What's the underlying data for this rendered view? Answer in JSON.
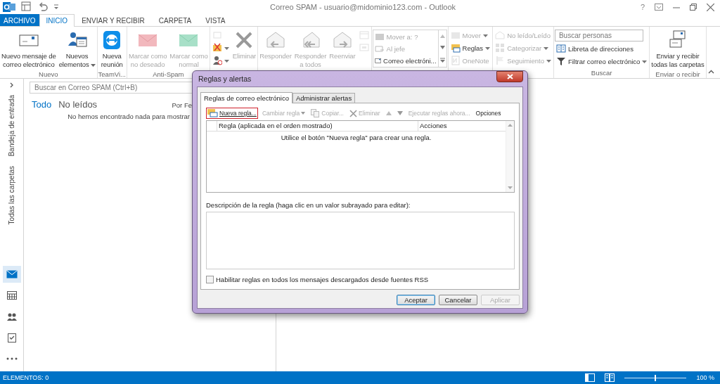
{
  "window": {
    "title": "Correo SPAM - usuario@midominio123.com - Outlook",
    "help": "?"
  },
  "ribbon_tabs": [
    {
      "label": "ARCHIVO",
      "kind": "file",
      "selected": false
    },
    {
      "label": "INICIO",
      "kind": "tab",
      "selected": true
    },
    {
      "label": "ENVIAR Y RECIBIR",
      "kind": "tab",
      "selected": false
    },
    {
      "label": "CARPETA",
      "kind": "tab",
      "selected": false
    },
    {
      "label": "VISTA",
      "kind": "tab",
      "selected": false
    }
  ],
  "ribbon_groups": [
    {
      "label": "Nuevo",
      "items": [
        {
          "kind": "large",
          "lines": [
            "Nuevo mensaje de",
            "correo electrónico"
          ],
          "dropdown": false,
          "disabled": false
        },
        {
          "kind": "large",
          "lines": [
            "Nuevos",
            "elementos"
          ],
          "dropdown": true,
          "disabled": false
        }
      ]
    },
    {
      "label": "TeamVi...",
      "items": [
        {
          "kind": "large",
          "lines": [
            "Nueva",
            "reunión"
          ],
          "dropdown": false,
          "disabled": false
        }
      ]
    },
    {
      "label": "Anti-Spam",
      "items": [
        {
          "kind": "large",
          "lines": [
            "Marcar como",
            "no deseado"
          ],
          "dropdown": false,
          "disabled": true
        },
        {
          "kind": "large",
          "lines": [
            "Marcar como",
            "normal"
          ],
          "dropdown": false,
          "disabled": true
        }
      ]
    },
    {
      "items": [
        {
          "kind": "stack",
          "items": [
            {
              "dropdown": false,
              "disabled": true
            },
            {
              "dropdown": true,
              "disabled": false
            },
            {
              "dropdown": true,
              "disabled": false
            }
          ]
        },
        {
          "kind": "large",
          "lines": [
            "Eliminar"
          ],
          "dropdown": false,
          "disabled": true
        }
      ]
    },
    {
      "items": [
        {
          "kind": "large",
          "lines": [
            "Responder"
          ],
          "dropdown": false,
          "disabled": true
        },
        {
          "kind": "large",
          "lines": [
            "Responder",
            "a todos"
          ],
          "dropdown": false,
          "disabled": true
        },
        {
          "kind": "large",
          "lines": [
            "Reenviar"
          ],
          "dropdown": false,
          "disabled": true
        },
        {
          "kind": "stack",
          "items": [
            {
              "dropdown": false,
              "disabled": true
            },
            {
              "dropdown": false,
              "disabled": true
            }
          ]
        }
      ]
    },
    {
      "items": [
        {
          "kind": "gallery",
          "items": [
            {
              "label": "Mover a: ?",
              "disabled": true
            },
            {
              "label": "Al jefe",
              "disabled": true
            },
            {
              "label": "Correo electróni...",
              "disabled": false
            }
          ]
        }
      ]
    },
    {
      "items": [
        {
          "kind": "stack",
          "items": [
            {
              "label": "Mover",
              "dropdown": true,
              "disabled": true
            },
            {
              "label": "Reglas",
              "dropdown": true,
              "disabled": false
            },
            {
              "label": "OneNote",
              "dropdown": false,
              "disabled": true
            }
          ]
        }
      ]
    },
    {
      "items": [
        {
          "kind": "stack",
          "items": [
            {
              "label": "No leído/Leído",
              "dropdown": false,
              "disabled": true
            },
            {
              "label": "Categorizar",
              "dropdown": true,
              "disabled": true
            },
            {
              "label": "Seguimiento",
              "dropdown": true,
              "disabled": true
            }
          ]
        }
      ]
    },
    {
      "label": "Buscar",
      "items": [
        {
          "kind": "stack",
          "items": [
            {
              "kind": "search",
              "placeholder": "Buscar personas"
            },
            {
              "label": "Libreta de direcciones",
              "dropdown": false,
              "disabled": false
            },
            {
              "label": "Filtrar correo electrónico",
              "dropdown": true,
              "disabled": false
            }
          ]
        }
      ]
    },
    {
      "label": "Enviar o recibir",
      "items": [
        {
          "kind": "large",
          "lines": [
            "Enviar y recibir",
            "todas las carpetas"
          ],
          "dropdown": false,
          "disabled": false
        }
      ]
    }
  ],
  "nav_pane": {
    "labels": [
      "Bandeja de entrada",
      "Todas las carpetas"
    ],
    "modules": [
      {
        "selected": true
      },
      {
        "selected": false
      },
      {
        "selected": false
      },
      {
        "selected": false
      },
      {
        "selected": false
      }
    ]
  },
  "message_list": {
    "search": {
      "placeholder": "Buscar en Correo SPAM (Ctrl+B)"
    },
    "filters": [
      {
        "label": "Todo",
        "selected": true
      },
      {
        "label": "No leídos",
        "selected": false
      }
    ],
    "sort": "Por Fe",
    "empty_text": "No hemos encontrado nada para mostrar"
  },
  "dialog": {
    "title": "Reglas y alertas",
    "tabs": [
      {
        "label": "Reglas de correo electrónico",
        "selected": true
      },
      {
        "label": "Administrar alertas",
        "selected": false
      }
    ],
    "toolbar": [
      {
        "label": "Nueva regla...",
        "kind": "new",
        "highlighted": true,
        "dropdown": false,
        "disabled": false
      },
      {
        "label": "Cambiar regla",
        "kind": "text",
        "highlighted": false,
        "dropdown": true,
        "disabled": true
      },
      {
        "label": "Copiar...",
        "kind": "copy",
        "highlighted": false,
        "dropdown": false,
        "disabled": true
      },
      {
        "label": "Eliminar",
        "kind": "delete",
        "highlighted": false,
        "dropdown": false,
        "disabled": true
      },
      {
        "kind": "up",
        "highlighted": false,
        "dropdown": false,
        "disabled": true
      },
      {
        "kind": "down",
        "highlighted": false,
        "dropdown": false,
        "disabled": true
      },
      {
        "label": "Ejecutar reglas ahora...",
        "kind": "text",
        "highlighted": false,
        "dropdown": false,
        "disabled": true
      },
      {
        "label": "Opciones",
        "kind": "text",
        "highlighted": false,
        "dropdown": false,
        "disabled": false
      }
    ],
    "table": {
      "columns": [
        "Regla (aplicada en el orden mostrado)",
        "Acciones"
      ],
      "empty_text": "Utilice el botón \"Nueva regla\" para crear una regla."
    },
    "description_label": "Descripción de la regla (haga clic en un valor subrayado para editar):",
    "rss_checkbox": {
      "label": "Habilitar reglas en todos los mensajes descargados desde fuentes RSS",
      "checked": false
    },
    "buttons": [
      {
        "label": "Aceptar",
        "default": true,
        "disabled": false
      },
      {
        "label": "Cancelar",
        "default": false,
        "disabled": false
      },
      {
        "label": "Aplicar",
        "default": false,
        "disabled": true
      }
    ]
  },
  "status_bar": {
    "items_count": "ELEMENTOS: 0",
    "zoom": {
      "level": 0.5
    },
    "zoom_label": "100 %"
  }
}
